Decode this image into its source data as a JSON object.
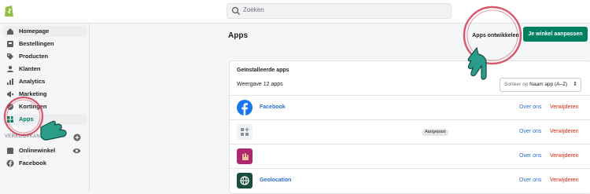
{
  "search": {
    "placeholder": "Zoeken"
  },
  "sidebar": {
    "items": [
      {
        "label": "Homepage",
        "icon": "home-icon"
      },
      {
        "label": "Bestellingen",
        "icon": "orders-icon"
      },
      {
        "label": "Producten",
        "icon": "tag-icon"
      },
      {
        "label": "Klanten",
        "icon": "customers-icon"
      },
      {
        "label": "Analytics",
        "icon": "analytics-icon"
      },
      {
        "label": "Marketing",
        "icon": "megaphone-icon"
      },
      {
        "label": "Kortingen",
        "icon": "discount-icon"
      },
      {
        "label": "Apps",
        "icon": "apps-icon"
      }
    ],
    "sales_channels_title": "VERKOOPKANALEN",
    "channels": [
      {
        "label": "Onlinewinkel",
        "icon": "store-icon"
      },
      {
        "label": "Facebook",
        "icon": "facebook-icon"
      }
    ]
  },
  "page": {
    "title": "Apps",
    "dev_button": "Apps ontwikkelen",
    "customize_button": "Je winkel aanpassen"
  },
  "card": {
    "title": "Geïnstalleerde apps",
    "count_text": "Weergave 12 apps",
    "sort_prefix": "Sorteer op",
    "sort_value": "Naam app (A–Z)"
  },
  "apps": [
    {
      "name": "Facebook",
      "badge": "",
      "about": "Over ons",
      "remove": "Verwijderen"
    },
    {
      "name": "",
      "badge": "Aangepast",
      "about": "Over ons",
      "remove": "Verwijderen"
    },
    {
      "name": "",
      "badge": "",
      "about": "Over ons",
      "remove": "Verwijderen"
    },
    {
      "name": "Geolocation",
      "badge": "",
      "about": "Over ons",
      "remove": "Verwijderen"
    }
  ],
  "colors": {
    "accent": "#008060",
    "link": "#2c6ecb",
    "danger": "#d72c0d",
    "highlight_circle": "#d23a52",
    "pointer": "#2a9d8a"
  }
}
